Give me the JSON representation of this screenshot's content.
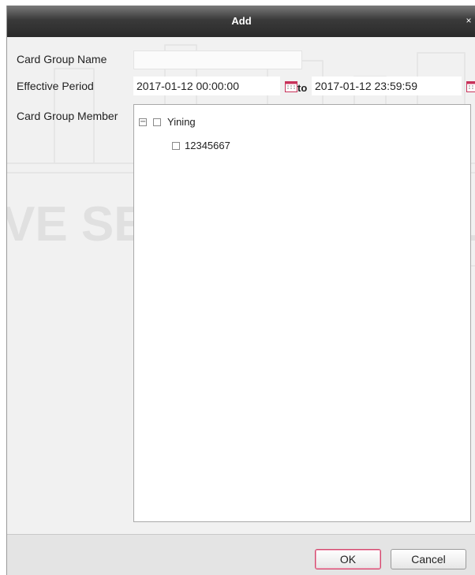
{
  "dialog": {
    "title": "Add",
    "close_icon": "close-icon"
  },
  "form": {
    "card_group_name_label": "Card Group Name",
    "card_group_name_value": "",
    "effective_period_label": "Effective Period",
    "start_datetime": "2017-01-12 00:00:00",
    "to_label": "to",
    "end_datetime": "2017-01-12 23:59:59",
    "calendar_icon": "calendar-icon",
    "card_group_member_label": "Card Group Member"
  },
  "tree": {
    "root": {
      "label": "Yining",
      "expanded": true,
      "checked": false
    },
    "children": [
      {
        "label": "12345667",
        "checked": false
      }
    ]
  },
  "watermark": {
    "text": "VE SECURE YOUR LI"
  },
  "buttons": {
    "ok_label": "OK",
    "cancel_label": "Cancel"
  },
  "colors": {
    "titlebar": "#2a2a2a",
    "ok_border": "#d24a6e",
    "calendar_accent": "#c8325a"
  }
}
